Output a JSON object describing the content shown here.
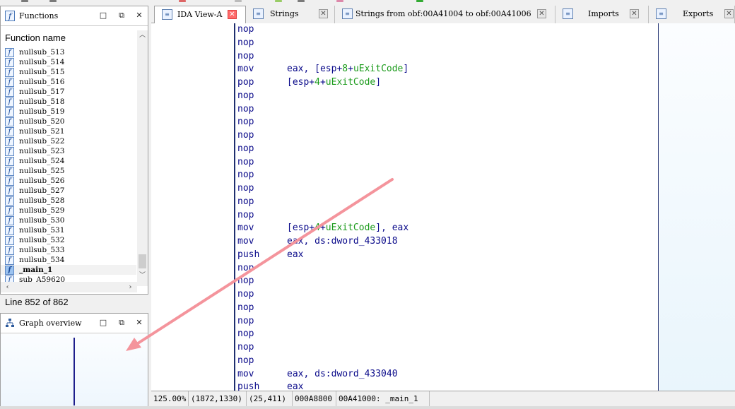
{
  "functions_pane": {
    "title": "Functions",
    "icon": "function-icon",
    "column_header": "Function name",
    "items": [
      {
        "icon": "f",
        "name": "nullsub_513"
      },
      {
        "icon": "f",
        "name": "nullsub_514"
      },
      {
        "icon": "f",
        "name": "nullsub_515"
      },
      {
        "icon": "f",
        "name": "nullsub_516"
      },
      {
        "icon": "f",
        "name": "nullsub_517"
      },
      {
        "icon": "f",
        "name": "nullsub_518"
      },
      {
        "icon": "f",
        "name": "nullsub_519"
      },
      {
        "icon": "f",
        "name": "nullsub_520"
      },
      {
        "icon": "f",
        "name": "nullsub_521"
      },
      {
        "icon": "f",
        "name": "nullsub_522"
      },
      {
        "icon": "f",
        "name": "nullsub_523"
      },
      {
        "icon": "f",
        "name": "nullsub_524"
      },
      {
        "icon": "f",
        "name": "nullsub_525"
      },
      {
        "icon": "f",
        "name": "nullsub_526"
      },
      {
        "icon": "f",
        "name": "nullsub_527"
      },
      {
        "icon": "f",
        "name": "nullsub_528"
      },
      {
        "icon": "f",
        "name": "nullsub_529"
      },
      {
        "icon": "f",
        "name": "nullsub_530"
      },
      {
        "icon": "f",
        "name": "nullsub_531"
      },
      {
        "icon": "f",
        "name": "nullsub_532"
      },
      {
        "icon": "f",
        "name": "nullsub_533"
      },
      {
        "icon": "f",
        "name": "nullsub_534"
      },
      {
        "icon": "f",
        "name": "_main_1",
        "selected": true
      },
      {
        "icon": "f",
        "name": "sub_A59620"
      }
    ],
    "status": "Line 852 of 862",
    "buttons": {
      "maximize": "□",
      "float": "⧉",
      "close": "✕"
    }
  },
  "graph_pane": {
    "title": "Graph overview",
    "icon": "graph-icon"
  },
  "tabs": [
    {
      "label": "IDA View-A",
      "icon": "ida-view-icon",
      "active": true
    },
    {
      "label": "Strings",
      "icon": "strings-icon",
      "active": false
    },
    {
      "label": "Strings from obf:00A41004 to obf:00A41006",
      "icon": "strings-icon",
      "active": false
    },
    {
      "label": "Imports",
      "icon": "imports-icon",
      "active": false
    },
    {
      "label": "Exports",
      "icon": "exports-icon",
      "active": false
    }
  ],
  "disassembly": [
    {
      "mnemonic": "nop",
      "operands": ""
    },
    {
      "mnemonic": "nop",
      "operands": ""
    },
    {
      "mnemonic": "nop",
      "operands": ""
    },
    {
      "mnemonic": "mov",
      "operands": "eax, [esp+8+uExitCode]"
    },
    {
      "mnemonic": "pop",
      "operands": "[esp+4+uExitCode]"
    },
    {
      "mnemonic": "nop",
      "operands": ""
    },
    {
      "mnemonic": "nop",
      "operands": ""
    },
    {
      "mnemonic": "nop",
      "operands": ""
    },
    {
      "mnemonic": "nop",
      "operands": ""
    },
    {
      "mnemonic": "nop",
      "operands": ""
    },
    {
      "mnemonic": "nop",
      "operands": ""
    },
    {
      "mnemonic": "nop",
      "operands": ""
    },
    {
      "mnemonic": "nop",
      "operands": ""
    },
    {
      "mnemonic": "nop",
      "operands": ""
    },
    {
      "mnemonic": "nop",
      "operands": ""
    },
    {
      "mnemonic": "mov",
      "operands": "[esp+4+uExitCode], eax"
    },
    {
      "mnemonic": "mov",
      "operands": "eax, ds:dword_433018"
    },
    {
      "mnemonic": "push",
      "operands": "eax"
    },
    {
      "mnemonic": "nop",
      "operands": ""
    },
    {
      "mnemonic": "nop",
      "operands": ""
    },
    {
      "mnemonic": "nop",
      "operands": ""
    },
    {
      "mnemonic": "nop",
      "operands": ""
    },
    {
      "mnemonic": "nop",
      "operands": ""
    },
    {
      "mnemonic": "nop",
      "operands": ""
    },
    {
      "mnemonic": "nop",
      "operands": ""
    },
    {
      "mnemonic": "nop",
      "operands": ""
    },
    {
      "mnemonic": "mov",
      "operands": "eax, ds:dword_433040"
    },
    {
      "mnemonic": "push",
      "operands": "eax"
    }
  ],
  "statusbar": {
    "zoom": "125.00%",
    "coords": "(1872,1330)",
    "pos": "(25,411)",
    "offset": "000A8800",
    "location": "00A41000: _main_1"
  },
  "colors": {
    "mnemonic": "#0a0a8a",
    "symbol": "#1a9a1a",
    "annotation_arrow": "#f4949c"
  }
}
